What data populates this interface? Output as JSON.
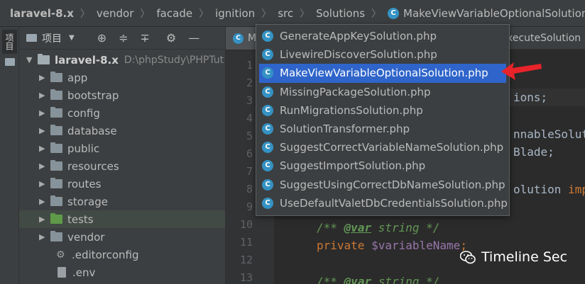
{
  "breadcrumb": {
    "items": [
      "laravel-8.x",
      "vendor",
      "facade",
      "ignition",
      "src",
      "Solutions"
    ],
    "current_file": "MakeViewVariableOptionalSolution.php"
  },
  "toolstrip": {
    "project_tab": "项目"
  },
  "project_panel": {
    "view_label": "项目",
    "icons": [
      "crosshair-icon",
      "expand-all-icon",
      "collapse-all-icon",
      "gear-icon",
      "minimize-icon"
    ],
    "root": {
      "name": "laravel-8.x",
      "path": "D:\\phpStudy\\PHPTut"
    },
    "folders": [
      "app",
      "bootstrap",
      "config",
      "database",
      "public",
      "resources",
      "routes",
      "storage",
      "tests",
      "vendor"
    ],
    "files": [
      ".editorconfig",
      ".env"
    ]
  },
  "editor": {
    "tab_left": "M",
    "tab_right": "xecuteSolution",
    "line_numbers": [
      "1",
      "2",
      "3",
      "4",
      "5",
      "6",
      "7",
      "8",
      "9",
      "10",
      "11",
      "12",
      "13"
    ],
    "code": {
      "l3_tail": "ions;",
      "l6_tail": "nnableSolut",
      "l7_tail": "Blade;",
      "l9_tail": "olution",
      "l9_kw": "imp",
      "l10_open": "/**",
      "l10_tag": "@var",
      "l10_rest": "string */",
      "l11_kw": "private",
      "l11_var": "$variableName",
      "l11_end": ";",
      "l13_open": "/**",
      "l13_tag": "@var",
      "l13_rest": "string */"
    }
  },
  "popup": {
    "items": [
      "GenerateAppKeySolution.php",
      "LivewireDiscoverSolution.php",
      "MakeViewVariableOptionalSolution.php",
      "MissingPackageSolution.php",
      "RunMigrationsSolution.php",
      "SolutionTransformer.php",
      "SuggestCorrectVariableNameSolution.php",
      "SuggestImportSolution.php",
      "SuggestUsingCorrectDbNameSolution.php",
      "UseDefaultValetDbCredentialsSolution.php"
    ],
    "selected_index": 2,
    "accent": "#2f65ca"
  },
  "annotation": {
    "arrow_color": "#e8232a"
  },
  "watermark": {
    "text": "Timeline Sec"
  }
}
